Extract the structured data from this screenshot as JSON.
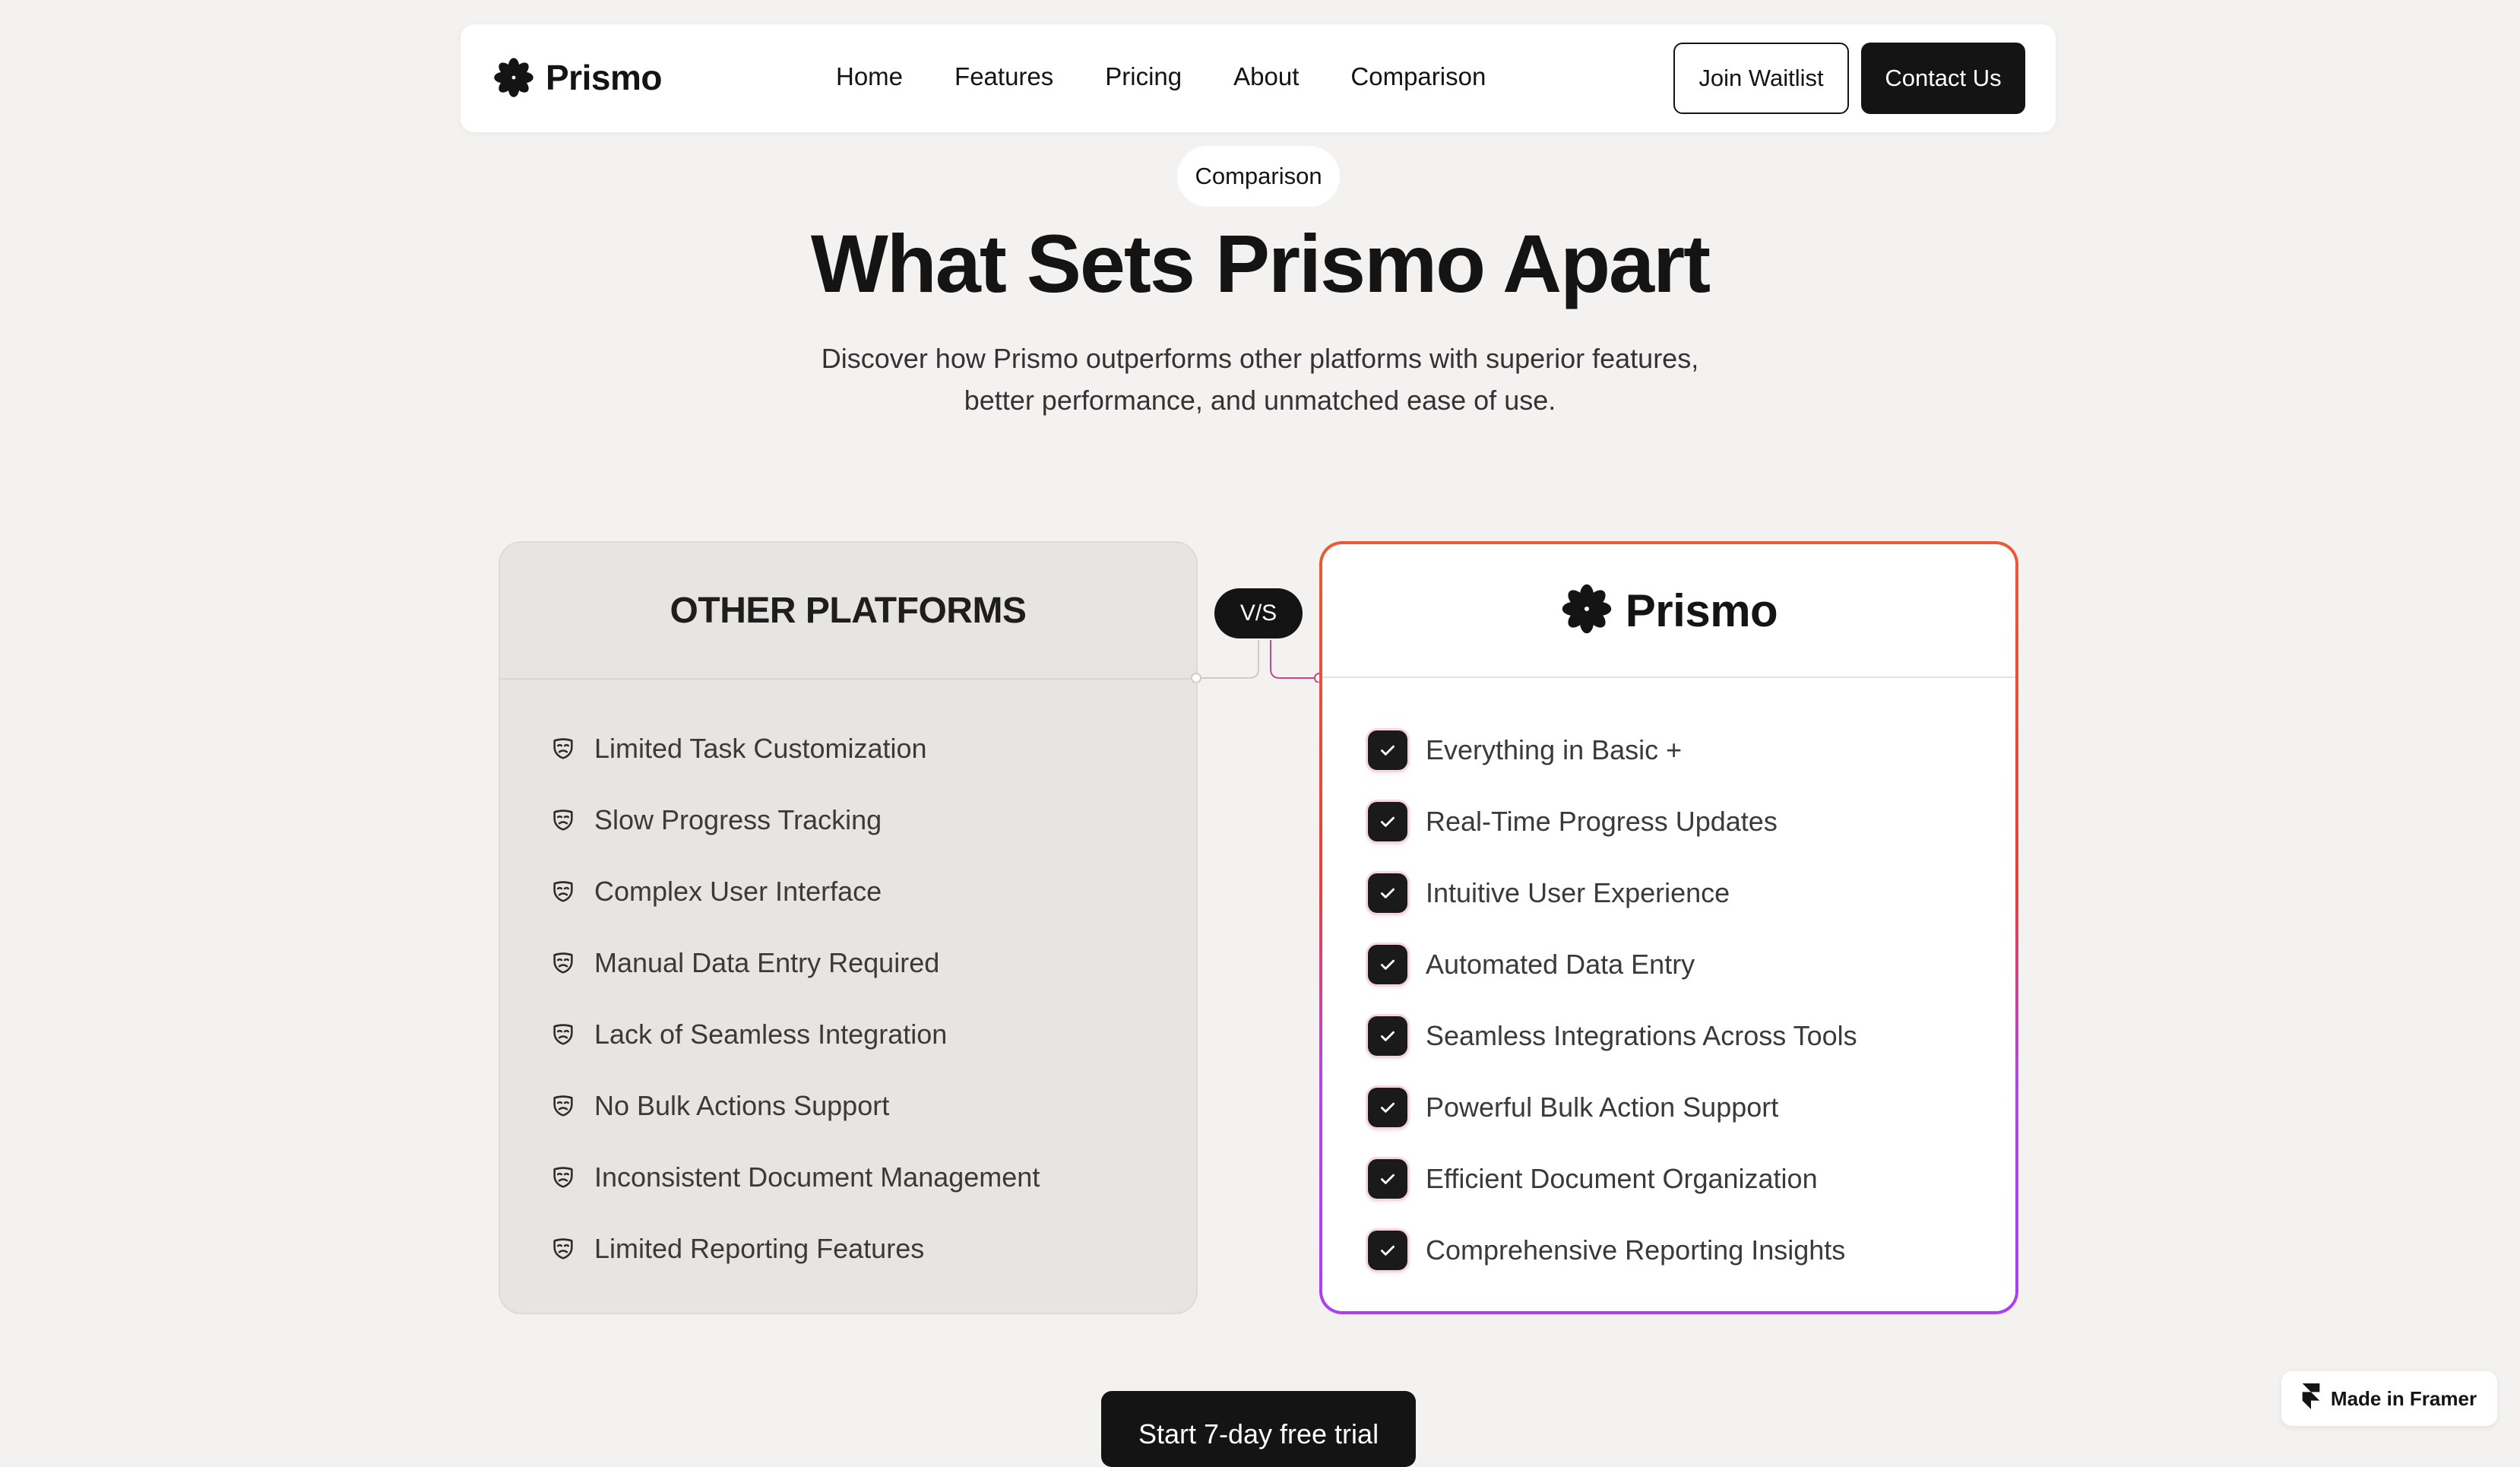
{
  "brand": {
    "name": "Prismo"
  },
  "nav": {
    "links": [
      "Home",
      "Features",
      "Pricing",
      "About",
      "Comparison"
    ],
    "join_label": "Join Waitlist",
    "contact_label": "Contact Us"
  },
  "hero": {
    "tag": "Comparison",
    "title": "What Sets Prismo Apart",
    "subtitle_line1": "Discover how Prismo outperforms other platforms with superior features,",
    "subtitle_line2": "better performance, and unmatched ease of use."
  },
  "comparison": {
    "vs_label": "V/S",
    "other": {
      "title": "OTHER PLATFORMS",
      "icon": "mask-icon",
      "items": [
        "Limited Task Customization",
        "Slow Progress Tracking",
        "Complex User Interface",
        "Manual Data Entry Required",
        "Lack of Seamless Integration",
        "No Bulk Actions Support",
        "Inconsistent Document Management",
        "Limited Reporting Features"
      ]
    },
    "prismo": {
      "title": "Prismo",
      "icon": "check-icon",
      "border_gradient": [
        "#ea5a34",
        "#a93ff0"
      ],
      "items": [
        "Everything in Basic +",
        "Real-Time Progress Updates",
        "Intuitive User Experience",
        "Automated Data Entry",
        "Seamless Integrations Across Tools",
        "Powerful Bulk Action Support",
        "Efficient Document Organization",
        "Comprehensive Reporting Insights"
      ]
    }
  },
  "cta": {
    "label": "Start 7-day free trial"
  },
  "framer_badge": {
    "label": "Made in Framer"
  },
  "colors": {
    "background": "#f3f2f0",
    "dark": "#141414",
    "accent_start": "#ea5a34",
    "accent_end": "#a93ff0"
  }
}
